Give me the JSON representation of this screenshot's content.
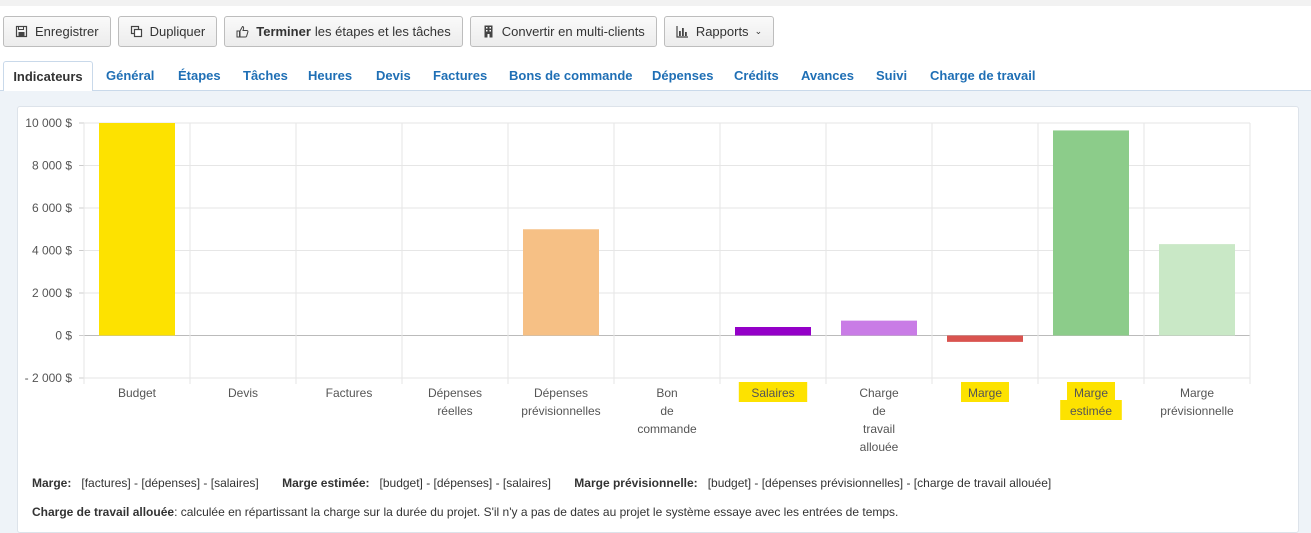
{
  "toolbar": {
    "save": "Enregistrer",
    "duplicate": "Dupliquer",
    "finish_bold": "Terminer",
    "finish_rest": "les étapes et les tâches",
    "convert": "Convertir en multi-clients",
    "reports": "Rapports"
  },
  "tabs": [
    {
      "label": "Indicateurs",
      "active": true
    },
    {
      "label": "Général"
    },
    {
      "label": "Étapes"
    },
    {
      "label": "Tâches"
    },
    {
      "label": "Heures"
    },
    {
      "label": "Devis"
    },
    {
      "label": "Factures"
    },
    {
      "label": "Bons de commande"
    },
    {
      "label": "Dépenses"
    },
    {
      "label": "Crédits"
    },
    {
      "label": "Avances"
    },
    {
      "label": "Suivi"
    },
    {
      "label": "Charge de travail"
    }
  ],
  "chart_data": {
    "type": "bar",
    "categories": [
      [
        "Budget"
      ],
      [
        "Devis"
      ],
      [
        "Factures"
      ],
      [
        "Dépenses",
        "réelles"
      ],
      [
        "Dépenses",
        "prévisionnelles"
      ],
      [
        "Bon",
        "de",
        "commande"
      ],
      [
        "Salaires"
      ],
      [
        "Charge",
        "de",
        "travail",
        "allouée"
      ],
      [
        "Marge"
      ],
      [
        "Marge",
        "estimée"
      ],
      [
        "Marge",
        "prévisionnelle"
      ]
    ],
    "values": [
      10000,
      0,
      0,
      0,
      5000,
      0,
      400,
      700,
      -300,
      9650,
      4300
    ],
    "colors": [
      "#fde200",
      "#cccccc",
      "#cccccc",
      "#cccccc",
      "#f6c085",
      "#cccccc",
      "#9400c8",
      "#c97ce6",
      "#d9534f",
      "#8ccc8a",
      "#c9e8c6"
    ],
    "highlighted_labels": [
      "Salaires",
      "Marge",
      "Marge estimée"
    ],
    "highlight_color": "#fde200",
    "ylim": [
      -2000,
      10000
    ],
    "yticks": [
      -2000,
      0,
      2000,
      4000,
      6000,
      8000,
      10000
    ],
    "ytick_labels": [
      "- 2 000 $",
      "0 $",
      "2 000 $",
      "4 000 $",
      "6 000 $",
      "8 000 $",
      "10 000 $"
    ],
    "grid": true
  },
  "legend": {
    "marge_label": "Marge:",
    "marge_formula": "[factures] - [dépenses] - [salaires]",
    "marge_estimee_label": "Marge estimée:",
    "marge_estimee_formula": "[budget] - [dépenses] - [salaires]",
    "marge_prev_label": "Marge prévisionnelle:",
    "marge_prev_formula": "[budget] - [dépenses prévisionnelles] - [charge de travail allouée]",
    "charge_label": "Charge de travail allouée",
    "charge_text": ": calculée en répartissant la charge sur la durée du projet. S'il n'y a pas de dates au projet le système essaye avec les entrées de temps."
  }
}
